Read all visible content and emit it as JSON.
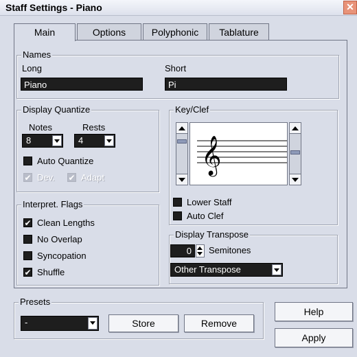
{
  "window": {
    "title": "Staff Settings - Piano",
    "close_label": "✕"
  },
  "tabs": [
    {
      "label": "Main",
      "active": true
    },
    {
      "label": "Options",
      "active": false
    },
    {
      "label": "Polyphonic",
      "active": false
    },
    {
      "label": "Tablature",
      "active": false
    }
  ],
  "names": {
    "group_label": "Names",
    "long_label": "Long",
    "long_value": "Piano",
    "short_label": "Short",
    "short_value": "Pi"
  },
  "display_quantize": {
    "group_label": "Display Quantize",
    "notes_label": "Notes",
    "notes_value": "8",
    "rests_label": "Rests",
    "rests_value": "4",
    "auto_quantize": {
      "label": "Auto Quantize",
      "checked": false
    },
    "dev": {
      "label": "Dev.",
      "checked": true,
      "enabled": false
    },
    "adapt": {
      "label": "Adapt",
      "checked": true,
      "enabled": false
    }
  },
  "key_clef": {
    "group_label": "Key/Clef",
    "lower_staff": {
      "label": "Lower Staff",
      "checked": false
    },
    "auto_clef": {
      "label": "Auto Clef",
      "checked": false
    }
  },
  "interpret_flags": {
    "group_label": "Interpret. Flags",
    "items": [
      {
        "label": "Clean Lengths",
        "checked": true
      },
      {
        "label": "No Overlap",
        "checked": false
      },
      {
        "label": "Syncopation",
        "checked": false
      },
      {
        "label": "Shuffle",
        "checked": true
      }
    ]
  },
  "display_transpose": {
    "group_label": "Display Transpose",
    "semitones_value": "0",
    "semitones_label": "Semitones",
    "transpose_select": "Other Transpose"
  },
  "presets": {
    "group_label": "Presets",
    "value": "-",
    "store_label": "Store",
    "remove_label": "Remove"
  },
  "buttons": {
    "help_label": "Help",
    "apply_label": "Apply"
  },
  "check_glyph": "✔",
  "colors": {
    "background": "#d9dde8",
    "field": "#1e1e1e",
    "close": "#e89379"
  }
}
